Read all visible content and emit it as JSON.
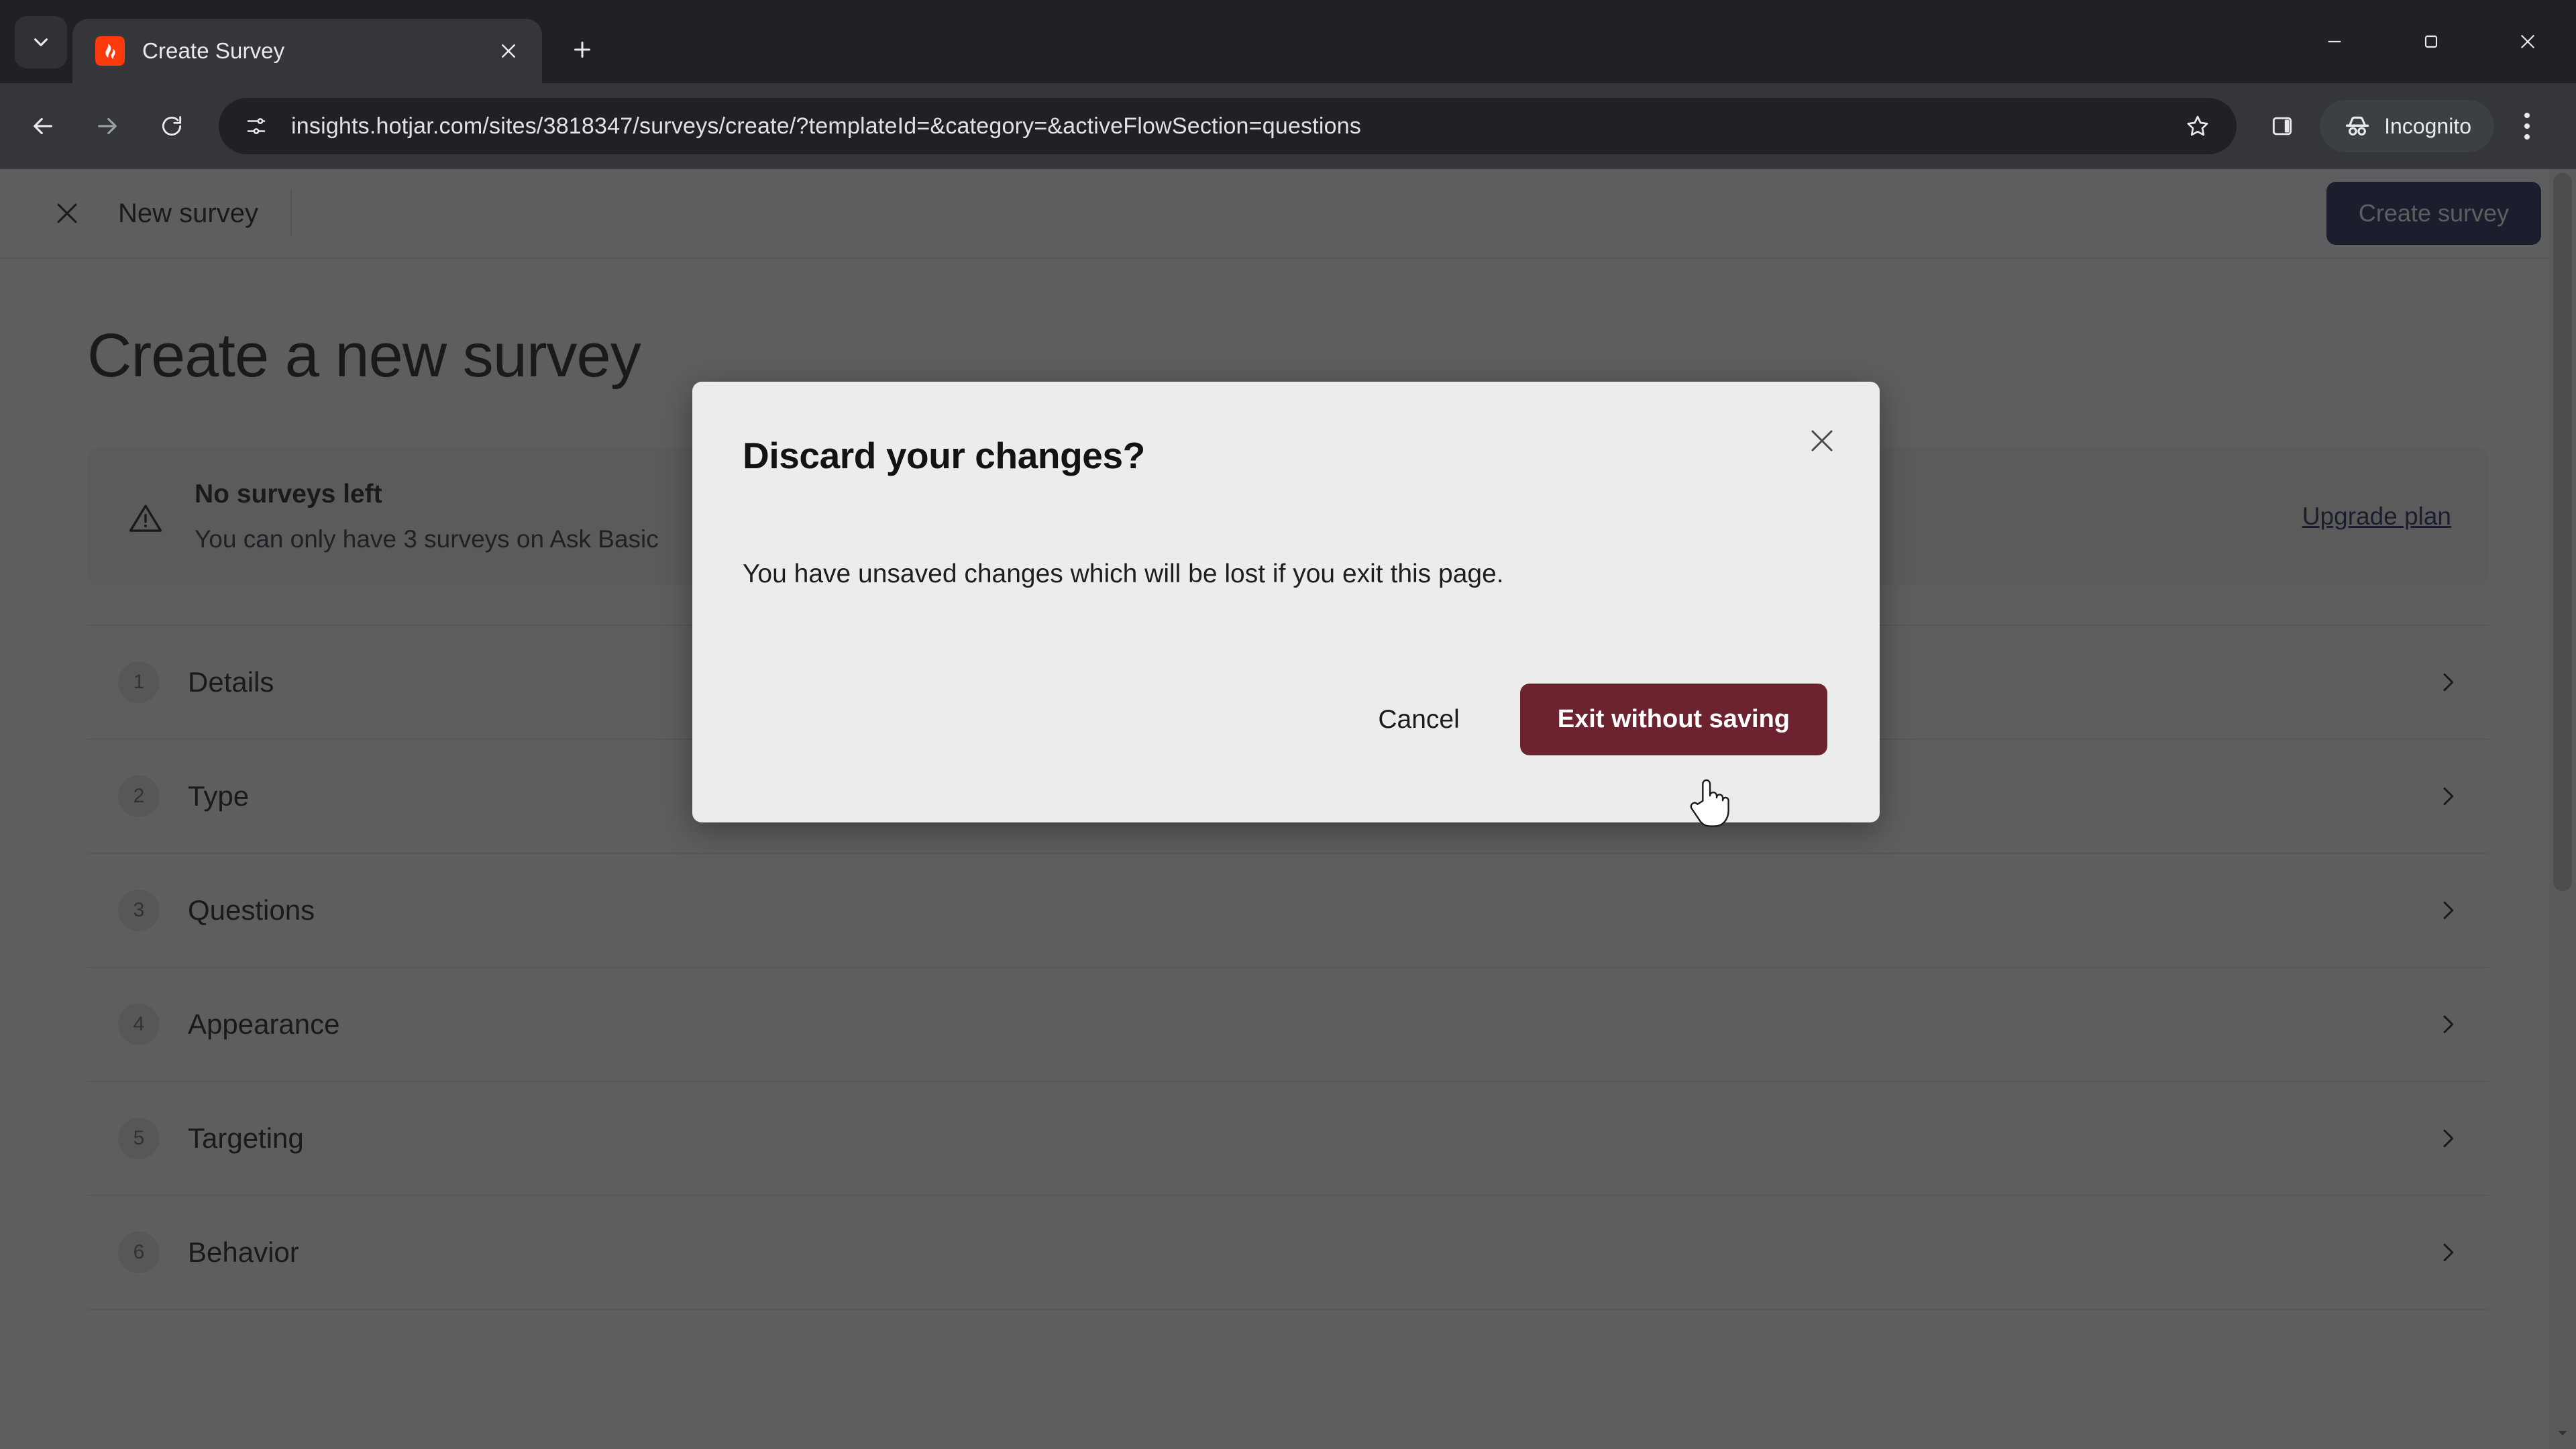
{
  "browser": {
    "tab": {
      "title": "Create Survey",
      "favicon": "hotjar-logo-icon",
      "close_icon": "close-icon"
    },
    "tab_search_icon": "chevron-down-icon",
    "new_tab_icon": "plus-icon",
    "window_controls": {
      "minimize": "minimize-icon",
      "maximize": "maximize-icon",
      "close": "close-icon"
    },
    "nav": {
      "back_icon": "arrow-left-icon",
      "forward_icon": "arrow-right-icon",
      "reload_icon": "reload-icon"
    },
    "omnibox": {
      "site_info_icon": "tune-icon",
      "url": "insights.hotjar.com/sites/3818347/surveys/create/?templateId=&category=&activeFlowSection=questions",
      "bookmark_icon": "star-icon"
    },
    "side_panel_icon": "side-panel-icon",
    "incognito": {
      "label": "Incognito",
      "icon": "incognito-icon"
    },
    "menu_icon": "three-dot-menu-icon"
  },
  "app": {
    "header": {
      "close_icon": "close-icon",
      "title": "New survey",
      "create_button": "Create survey"
    },
    "heading": "Create a new survey",
    "notice": {
      "icon": "warning-triangle-icon",
      "title": "No surveys left",
      "subtitle": "You can only have 3 surveys on Ask Basic",
      "link": "Upgrade plan"
    },
    "steps": [
      {
        "number": "1",
        "label": "Details",
        "chevron": "chevron-right-icon"
      },
      {
        "number": "2",
        "label": "Type",
        "chevron": "chevron-right-icon"
      },
      {
        "number": "3",
        "label": "Questions",
        "chevron": "chevron-right-icon"
      },
      {
        "number": "4",
        "label": "Appearance",
        "chevron": "chevron-right-icon"
      },
      {
        "number": "5",
        "label": "Targeting",
        "chevron": "chevron-right-icon"
      },
      {
        "number": "6",
        "label": "Behavior",
        "chevron": "chevron-right-icon"
      }
    ]
  },
  "modal": {
    "title": "Discard your changes?",
    "body": "You have unsaved changes which will be lost if you exit this page.",
    "close_icon": "close-icon",
    "cancel_label": "Cancel",
    "confirm_label": "Exit without saving",
    "confirm_color": "#6d2230"
  },
  "colors": {
    "brand_navy": "#1e2a52",
    "danger": "#6d2230",
    "favicon_red": "#fc3a0d",
    "chrome_dark": "#35363a",
    "tabstrip_dark": "#202124"
  }
}
